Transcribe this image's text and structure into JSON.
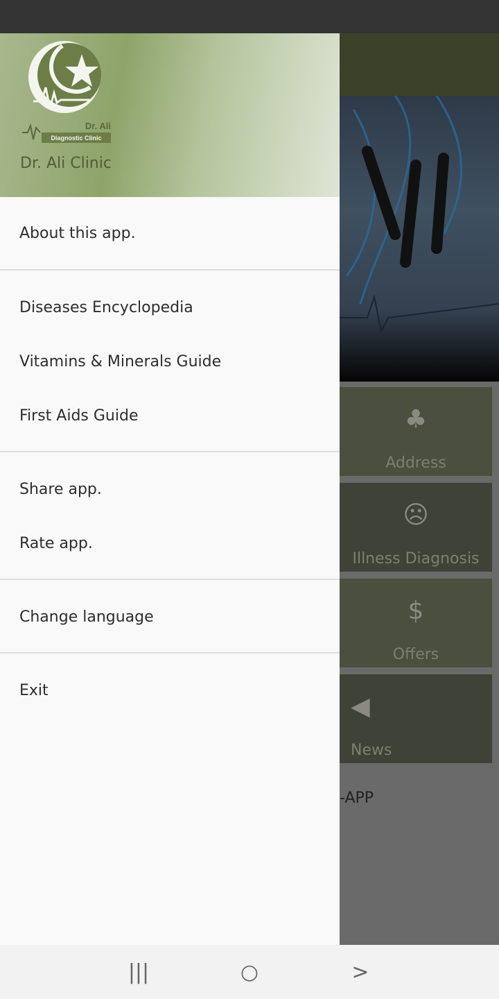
{
  "drawer": {
    "header": {
      "title": "Dr. Ali Clinic",
      "logo_text": [
        "Dr. Ali",
        "Diagnostic Clinic"
      ]
    },
    "groups": [
      [
        {
          "label": "About this app."
        }
      ],
      [
        {
          "label": "Diseases Encyclopedia"
        },
        {
          "label": "Vitamins & Minerals Guide"
        },
        {
          "label": "First Aids Guide"
        }
      ],
      [
        {
          "label": "Share app."
        },
        {
          "label": "Rate app."
        }
      ],
      [
        {
          "label": "Change language"
        }
      ],
      [
        {
          "label": "Exit"
        }
      ]
    ]
  },
  "background": {
    "tiles": [
      {
        "label": "Address",
        "icon": "tree-icon"
      },
      {
        "label": "Illness Diagnosis",
        "icon": "sick-face-icon"
      },
      {
        "label": "Offers",
        "icon": "price-tag-icon"
      },
      {
        "label": "News",
        "icon": "megaphone-icon"
      }
    ],
    "footer_text": "-APP"
  },
  "navbar": {
    "recent": "|||",
    "home": "○",
    "back": ">"
  }
}
